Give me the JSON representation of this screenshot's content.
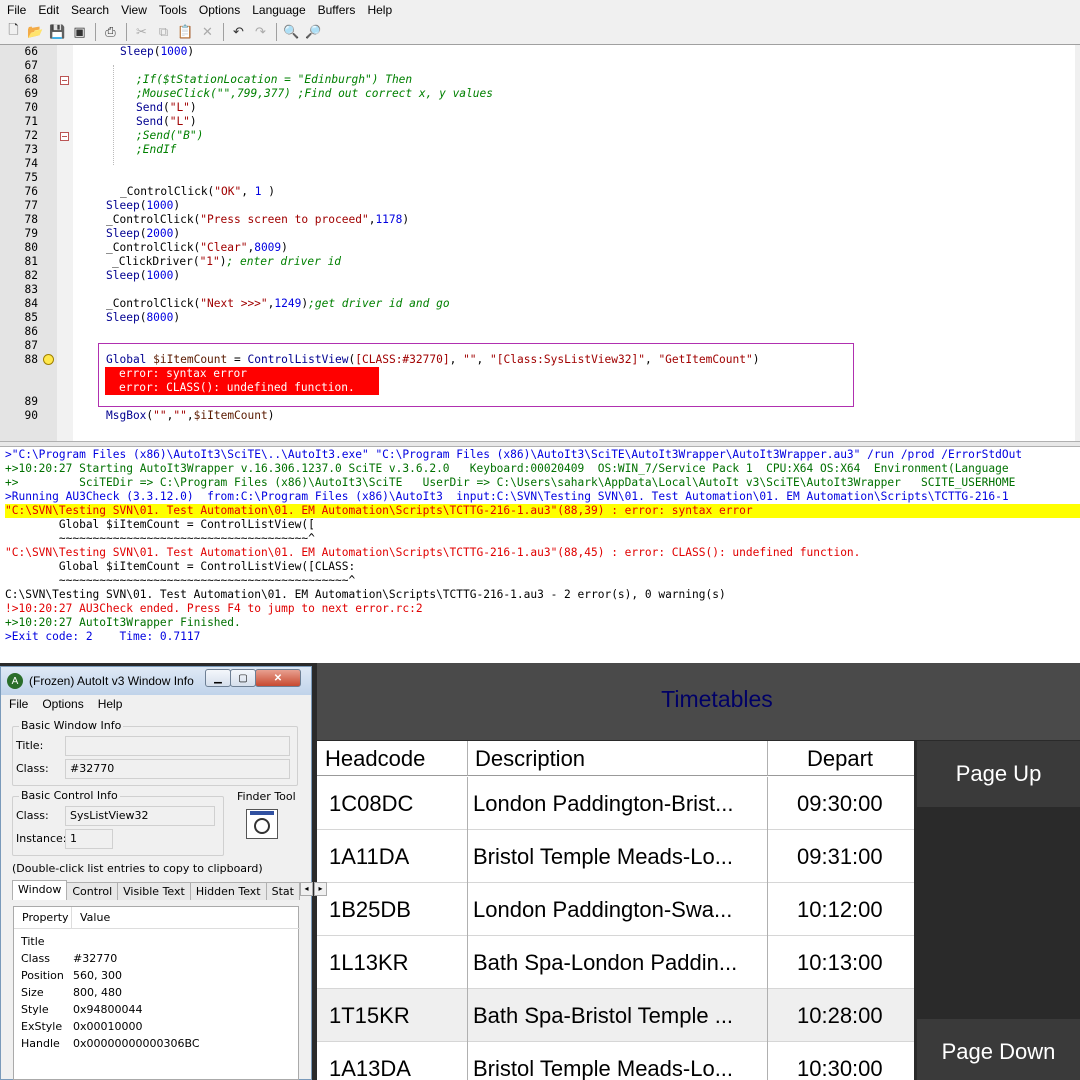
{
  "menu": [
    "File",
    "Edit",
    "Search",
    "View",
    "Tools",
    "Options",
    "Language",
    "Buffers",
    "Help"
  ],
  "toolbar": {
    "icons": [
      "new-file-icon",
      "open-folder-icon",
      "save-icon",
      "save-all-icon",
      "print-icon",
      "cut-icon",
      "copy-icon",
      "paste-icon",
      "delete-icon",
      "undo-icon",
      "redo-icon",
      "find-icon",
      "replace-icon"
    ]
  },
  "editor": {
    "lines": [
      {
        "n": "66",
        "html": "<span class=\"fn\">Sleep</span>(<span class=\"num\">1000</span>)",
        "indent": 42
      },
      {
        "n": "67",
        "html": "",
        "indent": 0
      },
      {
        "n": "68",
        "html": "<span class=\"cm\">;If($tStationLocation = \"Edinburgh\") Then</span>",
        "indent": 58,
        "fold": true
      },
      {
        "n": "69",
        "html": "<span class=\"cm\">;MouseClick(\"\",799,377) ;Find out correct x, y values</span>",
        "indent": 58
      },
      {
        "n": "70",
        "html": "<span class=\"fn\">Send</span>(<span class=\"str\">\"L\"</span>)",
        "indent": 58
      },
      {
        "n": "71",
        "html": "<span class=\"fn\">Send</span>(<span class=\"str\">\"L\"</span>)",
        "indent": 58
      },
      {
        "n": "72",
        "html": "<span class=\"cm\">;Send(\"B\")</span>",
        "indent": 58,
        "fold": true
      },
      {
        "n": "73",
        "html": "<span class=\"cm\">;EndIf</span>",
        "indent": 58
      },
      {
        "n": "74",
        "html": "",
        "indent": 0
      },
      {
        "n": "75",
        "html": "",
        "indent": 0
      },
      {
        "n": "76",
        "html": "_ControlClick(<span class=\"str\">\"OK\"</span>, <span class=\"num\">1</span> )",
        "indent": 42
      },
      {
        "n": "77",
        "html": "<span class=\"fn\">Sleep</span>(<span class=\"num\">1000</span>)",
        "indent": 28
      },
      {
        "n": "78",
        "html": "_ControlClick(<span class=\"str\">\"Press screen to proceed\"</span>,<span class=\"num\">1178</span>)",
        "indent": 28
      },
      {
        "n": "79",
        "html": "<span class=\"fn\">Sleep</span>(<span class=\"num\">2000</span>)",
        "indent": 28
      },
      {
        "n": "80",
        "html": "_ControlClick(<span class=\"str\">\"Clear\"</span>,<span class=\"num\">8009</span>)",
        "indent": 28
      },
      {
        "n": "81",
        "html": "_ClickDriver(<span class=\"str\">\"1\"</span>)<span class=\"cm\">; enter driver id</span>",
        "indent": 34
      },
      {
        "n": "82",
        "html": "<span class=\"fn\">Sleep</span>(<span class=\"num\">1000</span>)",
        "indent": 28
      },
      {
        "n": "83",
        "html": "",
        "indent": 0
      },
      {
        "n": "84",
        "html": "_ControlClick(<span class=\"str\">\"Next >>>\"</span>,<span class=\"num\">1249</span>)<span class=\"cm\">;get driver id and go</span>",
        "indent": 28
      },
      {
        "n": "85",
        "html": "<span class=\"fn\">Sleep</span>(<span class=\"num\">8000</span>)",
        "indent": 28
      },
      {
        "n": "86",
        "html": "",
        "indent": 0
      },
      {
        "n": "87",
        "html": "",
        "indent": 0
      }
    ],
    "line88": {
      "n": "88",
      "html": "<span class=\"fn\">Global</span> <span class=\"vr\">$iItemCount</span> = <span class=\"fn\">ControlListView</span>(<span class=\"str\">[CLASS:#32770]</span>, <span class=\"str\">\"\"</span>, <span class=\"str\">\"[Class:SysListView32]\"</span>, <span class=\"str\">\"GetItemCount\"</span>)"
    },
    "annotations": [
      "error: syntax error",
      "error: CLASS(): undefined function."
    ],
    "line89": "89",
    "line90": {
      "n": "90",
      "html": "<span class=\"fn\">MsgBox</span>(<span class=\"str\">\"\"</span>,<span class=\"str\">\"\"</span>,<span class=\"vr\">$iItemCount</span>)"
    }
  },
  "output": [
    {
      "c": "o-blue",
      "t": ">\"C:\\Program Files (x86)\\AutoIt3\\SciTE\\..\\AutoIt3.exe\" \"C:\\Program Files (x86)\\AutoIt3\\SciTE\\AutoIt3Wrapper\\AutoIt3Wrapper.au3\" /run /prod /ErrorStdOut"
    },
    {
      "c": "o-green",
      "t": "+>10:20:27 Starting AutoIt3Wrapper v.16.306.1237.0 SciTE v.3.6.2.0   Keyboard:00020409  OS:WIN_7/Service Pack 1  CPU:X64 OS:X64  Environment(Language"
    },
    {
      "c": "o-green",
      "t": "+>         SciTEDir => C:\\Program Files (x86)\\AutoIt3\\SciTE   UserDir => C:\\Users\\sahark\\AppData\\Local\\AutoIt v3\\SciTE\\AutoIt3Wrapper   SCITE_USERHOME"
    },
    {
      "c": "o-blue",
      "t": ">Running AU3Check (3.3.12.0)  from:C:\\Program Files (x86)\\AutoIt3  input:C:\\SVN\\Testing SVN\\01. Test Automation\\01. EM Automation\\Scripts\\TCTTG-216-1"
    },
    {
      "c": "o-err",
      "t": "\"C:\\SVN\\Testing SVN\\01. Test Automation\\01. EM Automation\\Scripts\\TCTTG-216-1.au3\"(88,39) : error: syntax error"
    },
    {
      "c": "o-black",
      "t": "        Global $iItemCount = ControlListView(["
    },
    {
      "c": "o-black",
      "t": "        ~~~~~~~~~~~~~~~~~~~~~~~~~~~~~~~~~~~~~^"
    },
    {
      "c": "o-red",
      "t": "\"C:\\SVN\\Testing SVN\\01. Test Automation\\01. EM Automation\\Scripts\\TCTTG-216-1.au3\"(88,45) : error: CLASS(): undefined function."
    },
    {
      "c": "o-black",
      "t": "        Global $iItemCount = ControlListView([CLASS:"
    },
    {
      "c": "o-black",
      "t": "        ~~~~~~~~~~~~~~~~~~~~~~~~~~~~~~~~~~~~~~~~~~~^"
    },
    {
      "c": "o-black",
      "t": "C:\\SVN\\Testing SVN\\01. Test Automation\\01. EM Automation\\Scripts\\TCTTG-216-1.au3 - 2 error(s), 0 warning(s)"
    },
    {
      "c": "o-red",
      "t": "!>10:20:27 AU3Check ended. Press F4 to jump to next error.rc:2"
    },
    {
      "c": "o-green",
      "t": "+>10:20:27 AutoIt3Wrapper Finished."
    },
    {
      "c": "o-blue",
      "t": ">Exit code: 2    Time: 0.7117"
    }
  ],
  "timetable": {
    "title": "Timetables",
    "headers": [
      "Headcode",
      "Description",
      "Depart"
    ],
    "rows": [
      [
        "1C08DC",
        "London Paddington-Brist...",
        "09:30:00"
      ],
      [
        "1A11DA",
        "Bristol Temple Meads-Lo...",
        "09:31:00"
      ],
      [
        "1B25DB",
        "London Paddington-Swa...",
        "10:12:00"
      ],
      [
        "1L13KR",
        "Bath Spa-London Paddin...",
        "10:13:00"
      ],
      [
        "1T15KR",
        "Bath Spa-Bristol Temple ...",
        "10:28:00"
      ],
      [
        "1A13DA",
        "Bristol Temple Meads-Lo...",
        "10:30:00"
      ]
    ],
    "page_up": "Page Up",
    "page_down": "Page Down"
  },
  "window_info": {
    "title": "(Frozen) AutoIt v3 Window Info",
    "menu": [
      "File",
      "Options",
      "Help"
    ],
    "basic_window_info": "Basic Window Info",
    "title_label": "Title:",
    "title_value": "",
    "class_label": "Class:",
    "class_value": "#32770",
    "basic_control_info": "Basic Control Info",
    "control_class_label": "Class:",
    "control_class_value": "SysListView32",
    "instance_label": "Instance:",
    "instance_value": "1",
    "finder_tool": "Finder Tool",
    "hint": "(Double-click list entries to copy to clipboard)",
    "tabs": [
      "Window",
      "Control",
      "Visible Text",
      "Hidden Text",
      "Stat"
    ],
    "prop_headers": [
      "Property",
      "Value"
    ],
    "props": [
      [
        "Title",
        ""
      ],
      [
        "Class",
        "#32770"
      ],
      [
        "Position",
        "560, 300"
      ],
      [
        "Size",
        "800, 480"
      ],
      [
        "Style",
        "0x94800044"
      ],
      [
        "ExStyle",
        "0x00010000"
      ],
      [
        "Handle",
        "0x00000000000306BC"
      ]
    ]
  }
}
